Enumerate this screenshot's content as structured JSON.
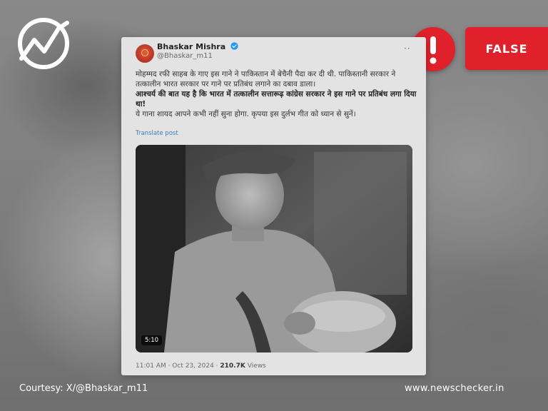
{
  "verdict": {
    "label": "FALSE",
    "color": "#e0202b"
  },
  "tweet": {
    "display_name": "Bhaskar Mishra",
    "handle": "@Bhaskar_m11",
    "more_label": "··",
    "text_line1": "मोहम्मद रफी साहब के गाए इस गाने ने पाकिस्तान में बेचैनी पैदा कर दी थी. पाकिस्तानी सरकार ने तत्कालीन भारत सरकार पर गाने पर प्रतिबंध लगाने का दबाव डाला।",
    "text_bold": "आश्चर्य की बात यह है कि भारत में तत्कालीन सत्तारूढ़ कांग्रेस सरकार ने इस गाने पर प्रतिबंध लगा दिया था!",
    "text_line3": "ये गाना शायद आपने कभी नहीं सुना होगा.  कृपया इस दुर्लभ गीत को ध्यान से सुनें।",
    "translate_label": "Translate post",
    "video_duration": "5:10",
    "timestamp": "11:01 AM · Oct 23, 2024 · ",
    "views_count": "210.7K",
    "views_label": " Views"
  },
  "footer": {
    "credit": "Courtesy: X/@Bhaskar_m11",
    "site": "www.newschecker.in"
  },
  "icons": [
    "newschecker-logo-icon",
    "alert-icon",
    "verified-icon",
    "more-icon"
  ],
  "accent_color": "#e0202b"
}
